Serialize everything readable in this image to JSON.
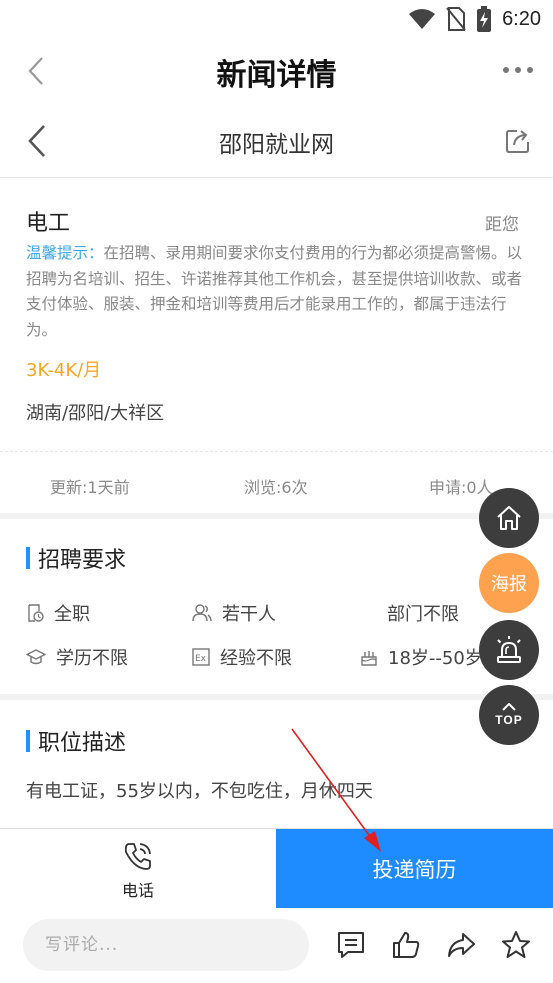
{
  "status_bar": {
    "time": "6:20"
  },
  "nav": {
    "title": "新闻详情"
  },
  "site": {
    "title": "邵阳就业网"
  },
  "job": {
    "title": "电工",
    "distance_label": "距您",
    "notice_label": "温馨提示：",
    "notice_text": "在招聘、录用期间要求你支付费用的行为都必须提高警惕。以招聘为名培训、招生、许诺推荐其他工作机会，甚至提供培训收款、或者支付体验、服装、押金和培训等费用后才能录用工作的，都属于违法行为。",
    "salary": "3K-4K/月",
    "location": "湖南/邵阳/大祥区"
  },
  "stats": {
    "updated": "更新:1天前",
    "views": "浏览:6次",
    "applications": "申请:0人"
  },
  "requirements": {
    "title": "招聘要求",
    "type": "全职",
    "headcount": "若干人",
    "department": "部门不限",
    "education": "学历不限",
    "experience": "经验不限",
    "age": "18岁--50岁"
  },
  "description": {
    "title": "职位描述",
    "text": "有电工证，55岁以内，不包吃住，月休四天"
  },
  "actions": {
    "phone_label": "电话",
    "apply_label": "投递简历"
  },
  "comment": {
    "placeholder": "写评论..."
  },
  "floating": {
    "poster_label": "海报",
    "top_label": "TOP"
  },
  "colors": {
    "accent": "#1e8cff",
    "salary": "#f5a623",
    "notice": "#3fa9e6",
    "poster": "#ffa24f",
    "annotation_arrow": "#e02020"
  }
}
